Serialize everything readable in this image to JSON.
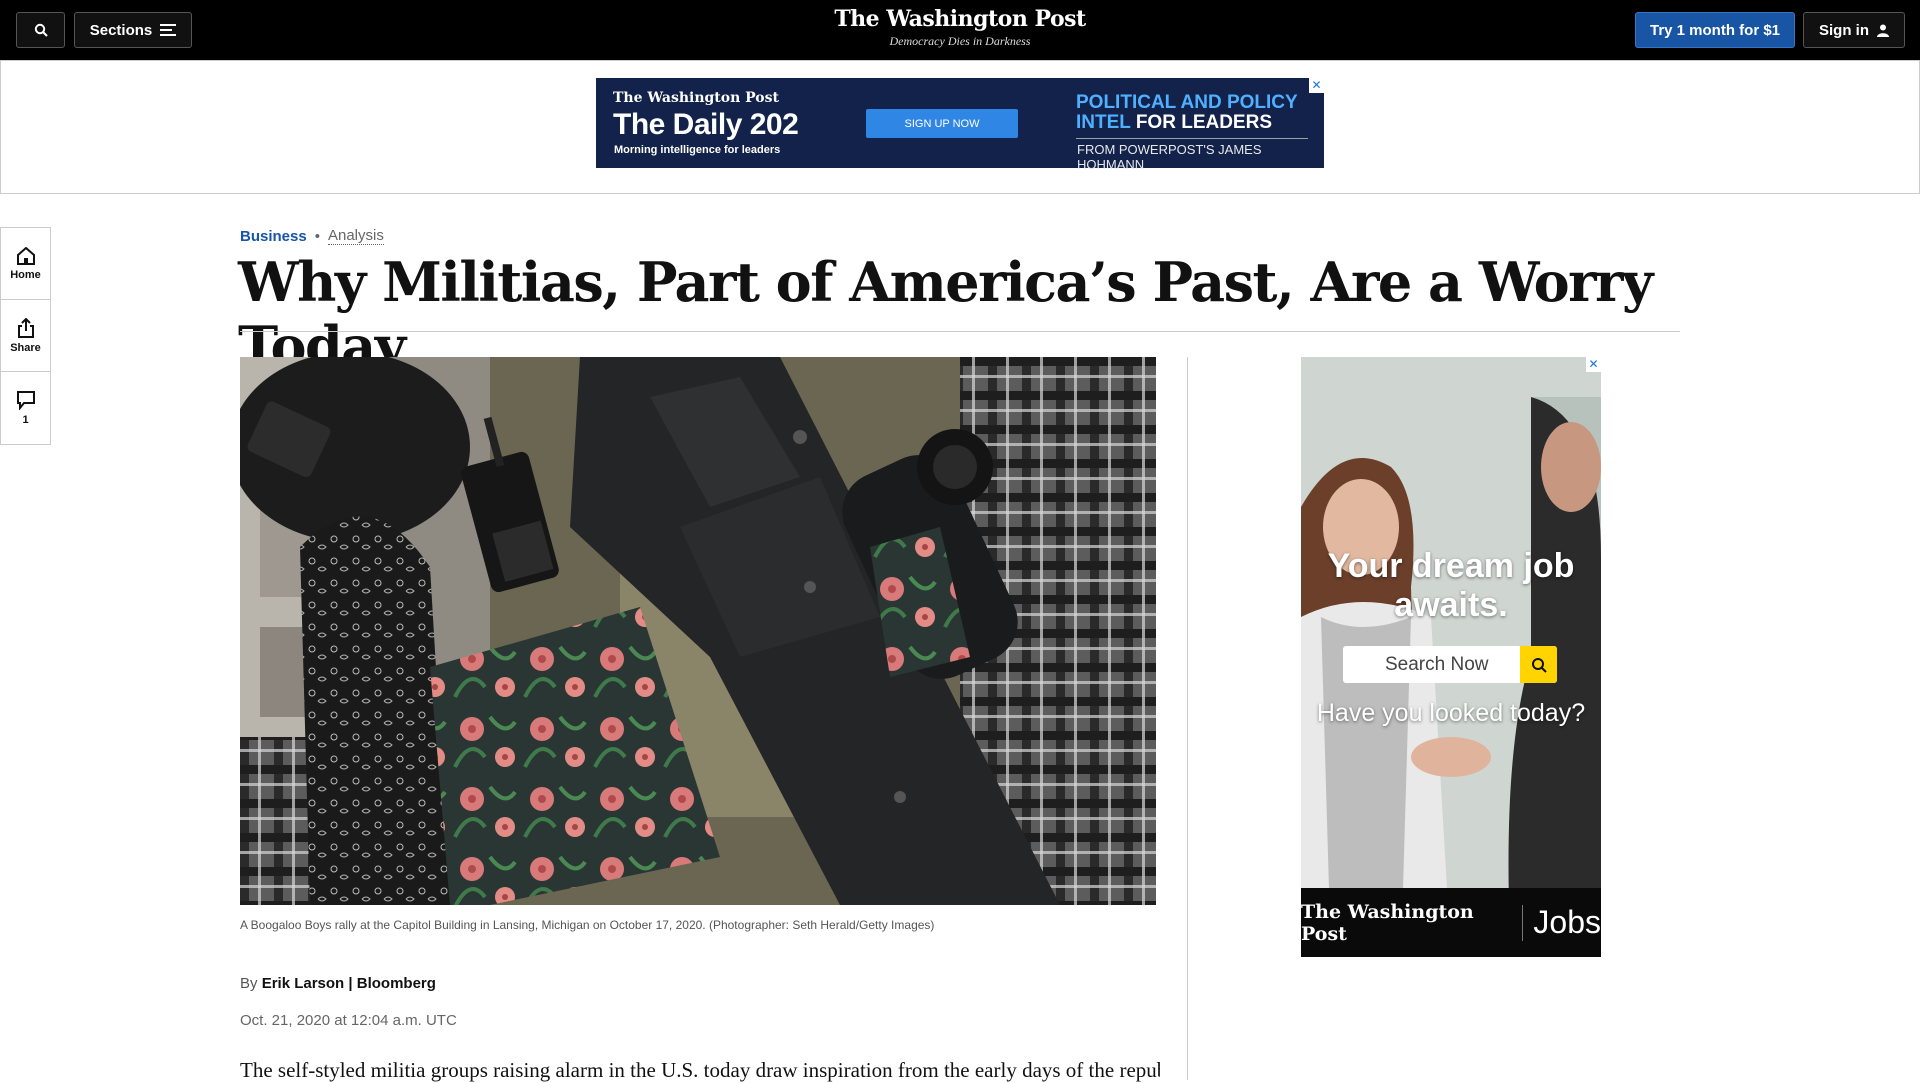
{
  "header": {
    "sections_label": "Sections",
    "logo": "The Washington Post",
    "tagline": "Democracy Dies in Darkness",
    "subscribe_label": "Try 1 month for $1",
    "signin_label": "Sign in"
  },
  "top_ad": {
    "logo": "The Washington Post",
    "title": "The Daily 202",
    "subtitle": "Morning intelligence for leaders",
    "button": "SIGN UP NOW",
    "headline_line1": "POLITICAL AND POLICY",
    "headline_line2_blue": "INTEL",
    "headline_line2_rest": " FOR LEADERS",
    "from": "FROM POWERPOST'S JAMES HOHMANN"
  },
  "rail": {
    "home": "Home",
    "share": "Share",
    "comments": "1"
  },
  "article": {
    "section": "Business",
    "label": "Analysis",
    "headline": "Why Militias, Part of America’s Past, Are a Worry Today",
    "caption": "A Boogaloo Boys rally at the Capitol Building in Lansing, Michigan on October 17, 2020. (Photographer: Seth Herald/Getty Images)",
    "by": "By",
    "author": "Erik Larson | Bloomberg",
    "date": "Oct. 21, 2020 at 12:04 a.m. UTC",
    "body_first_line": "The self-styled militia groups raising alarm in the U.S. today draw inspiration from the early days of the republic,"
  },
  "side_ad": {
    "headline": "Your dream job awaits.",
    "search_placeholder": "Search Now",
    "tagline": "Have you looked today?",
    "footer_logo": "The Washington Post",
    "footer_jobs": "Jobs"
  },
  "colors": {
    "accent": "#1955a5",
    "topbar": "#000000",
    "ad_navy": "#12224a"
  }
}
